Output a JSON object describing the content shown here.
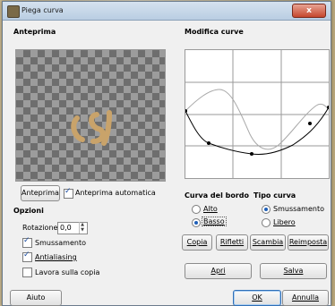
{
  "window": {
    "title": "Piega curva",
    "close_symbol": "x"
  },
  "preview": {
    "section_title": "Anteprima",
    "button_label": "Anteprima",
    "auto_preview_label": "Anteprima automatica",
    "auto_preview_checked": true
  },
  "options": {
    "section_title": "Opzioni",
    "rotation_label": "Rotazione:",
    "rotation_value": "0,0",
    "smoothing_label": "Smussamento",
    "smoothing_checked": true,
    "antialiasing_label": "Antialiasing",
    "antialiasing_checked": true,
    "work_on_copy_label": "Lavora sulla copia",
    "work_on_copy_checked": false
  },
  "curves": {
    "section_title": "Modifica curve",
    "edge_title": "Curva del bordo",
    "edge_options": [
      "Alto",
      "Basso"
    ],
    "edge_selected": "Basso",
    "type_title": "Tipo curva",
    "type_options": [
      "Smussamento",
      "Libero"
    ],
    "type_selected": "Smussamento",
    "buttons": [
      "Copia",
      "Rifletti",
      "Scambia",
      "Reimposta"
    ],
    "open_label": "Apri",
    "save_label": "Salva"
  },
  "footer": {
    "help_label": "Aiuto",
    "ok_label": "OK",
    "cancel_label": "Annulla"
  },
  "colors": {
    "preview_mark": "#c9a36a",
    "upper_curve": "#a8a8a8",
    "lower_curve": "#000000"
  }
}
